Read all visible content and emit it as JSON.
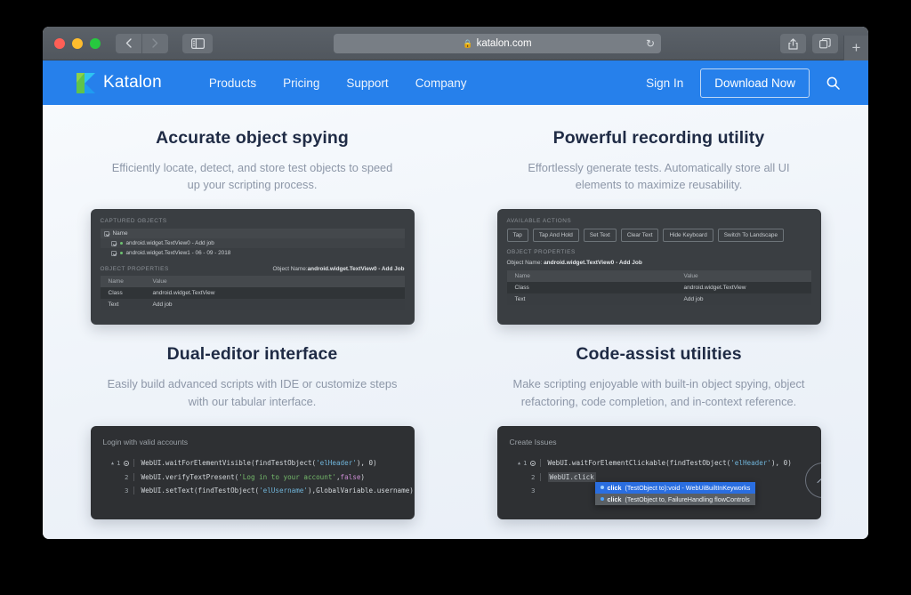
{
  "browser": {
    "url": "katalon.com",
    "lock_icon": "lock-icon",
    "reload_icon": "reload-icon",
    "back_icon": "chevron-left-icon",
    "forward_icon": "chevron-right-icon",
    "sidebar_icon": "sidebar-toggle-icon",
    "share_icon": "share-icon",
    "tabs_icon": "show-tabs-icon",
    "newtab_icon": "plus-icon"
  },
  "site_header": {
    "brand": "Katalon",
    "nav": [
      {
        "label": "Products"
      },
      {
        "label": "Pricing"
      },
      {
        "label": "Support"
      },
      {
        "label": "Company"
      }
    ],
    "sign_in": "Sign In",
    "download": "Download Now",
    "search_icon": "search-icon",
    "accent_color": "#2680eb"
  },
  "features": [
    {
      "id": "object-spying",
      "title": "Accurate object spying",
      "desc": "Efficiently locate, detect, and store test objects to speed up your scripting process."
    },
    {
      "id": "recording-utility",
      "title": "Powerful recording utility",
      "desc": "Effortlessly generate tests. Automatically store all UI elements to maximize reusability."
    },
    {
      "id": "dual-editor",
      "title": "Dual-editor interface",
      "desc": "Easily build advanced scripts with IDE or customize steps with our tabular interface."
    },
    {
      "id": "code-assist",
      "title": "Code-assist utilities",
      "desc": "Make scripting enjoyable with built-in object spying, object refactoring, code completion, and in-context reference."
    }
  ],
  "panel_captured": {
    "section_title": "CAPTURED OBJECTS",
    "tree_header": "Name",
    "tree_rows": [
      {
        "label": "android.widget.TextView0 - Add job"
      },
      {
        "label": "android.widget.TextView1 - 06 - 09 - 2018"
      }
    ],
    "props_title": "OBJECT PROPERTIES",
    "object_name_label": "Object Name:",
    "object_name_value": "android.widget.TextView0 - Add Job",
    "table_headers": [
      "Name",
      "Value"
    ],
    "table_rows": [
      [
        "Class",
        "android.widget.TextView"
      ],
      [
        "Text",
        "Add job"
      ]
    ]
  },
  "panel_actions": {
    "section_title": "AVAILABLE ACTIONS",
    "buttons": [
      "Tap",
      "Tap And Hold",
      "Set Text",
      "Clear Text",
      "Hide Keyboard",
      "Switch To Landscape"
    ],
    "props_title": "OBJECT PROPERTIES",
    "object_name_label": "Object Name:",
    "object_name_value": "android.widget.TextView0 - Add Job",
    "table_headers": [
      "Name",
      "Value"
    ],
    "table_rows": [
      [
        "Class",
        "android.widget.TextView"
      ],
      [
        "Text",
        "Add job"
      ]
    ]
  },
  "panel_editor": {
    "title": "Login with valid accounts",
    "lines": [
      {
        "num": "1",
        "segments": [
          {
            "t": "WebUI.waitForElementVisible(findTestObject(",
            "c": "plain"
          },
          {
            "t": "'elHeader'",
            "c": "str"
          },
          {
            "t": "), 0)",
            "c": "plain"
          }
        ]
      },
      {
        "num": "2",
        "segments": [
          {
            "t": "WebUI.verifyTextPresent(",
            "c": "plain"
          },
          {
            "t": "'Log in to your account'",
            "c": "str-g"
          },
          {
            "t": ",",
            "c": "plain"
          },
          {
            "t": "false",
            "c": "kw"
          },
          {
            "t": ")",
            "c": "plain"
          }
        ]
      },
      {
        "num": "3",
        "segments": [
          {
            "t": "WebUI.setText(findTestObject(",
            "c": "plain"
          },
          {
            "t": "'elUsername'",
            "c": "str"
          },
          {
            "t": "),GlobalVariable.username)",
            "c": "plain"
          }
        ]
      }
    ]
  },
  "panel_codeassist": {
    "title": "Create Issues",
    "lines": [
      {
        "num": "1",
        "segments": [
          {
            "t": "WebUI.waitForElementClickable(findTestObject(",
            "c": "plain"
          },
          {
            "t": "'elHeader'",
            "c": "str"
          },
          {
            "t": "), 0)",
            "c": "plain"
          }
        ]
      },
      {
        "num": "2",
        "segments": [
          {
            "t": "WebUI.click",
            "c": "hl"
          }
        ]
      },
      {
        "num": "3",
        "segments": []
      }
    ],
    "autocomplete": [
      {
        "name": "click",
        "rest": "(TestObject to):void - WebUiBuiltInKeyworks",
        "selected": true
      },
      {
        "name": "click",
        "rest": "(TestObject to, FailureHandling flowControls",
        "selected": false
      }
    ]
  },
  "scroll_top": {
    "icon": "chevron-up-icon"
  }
}
